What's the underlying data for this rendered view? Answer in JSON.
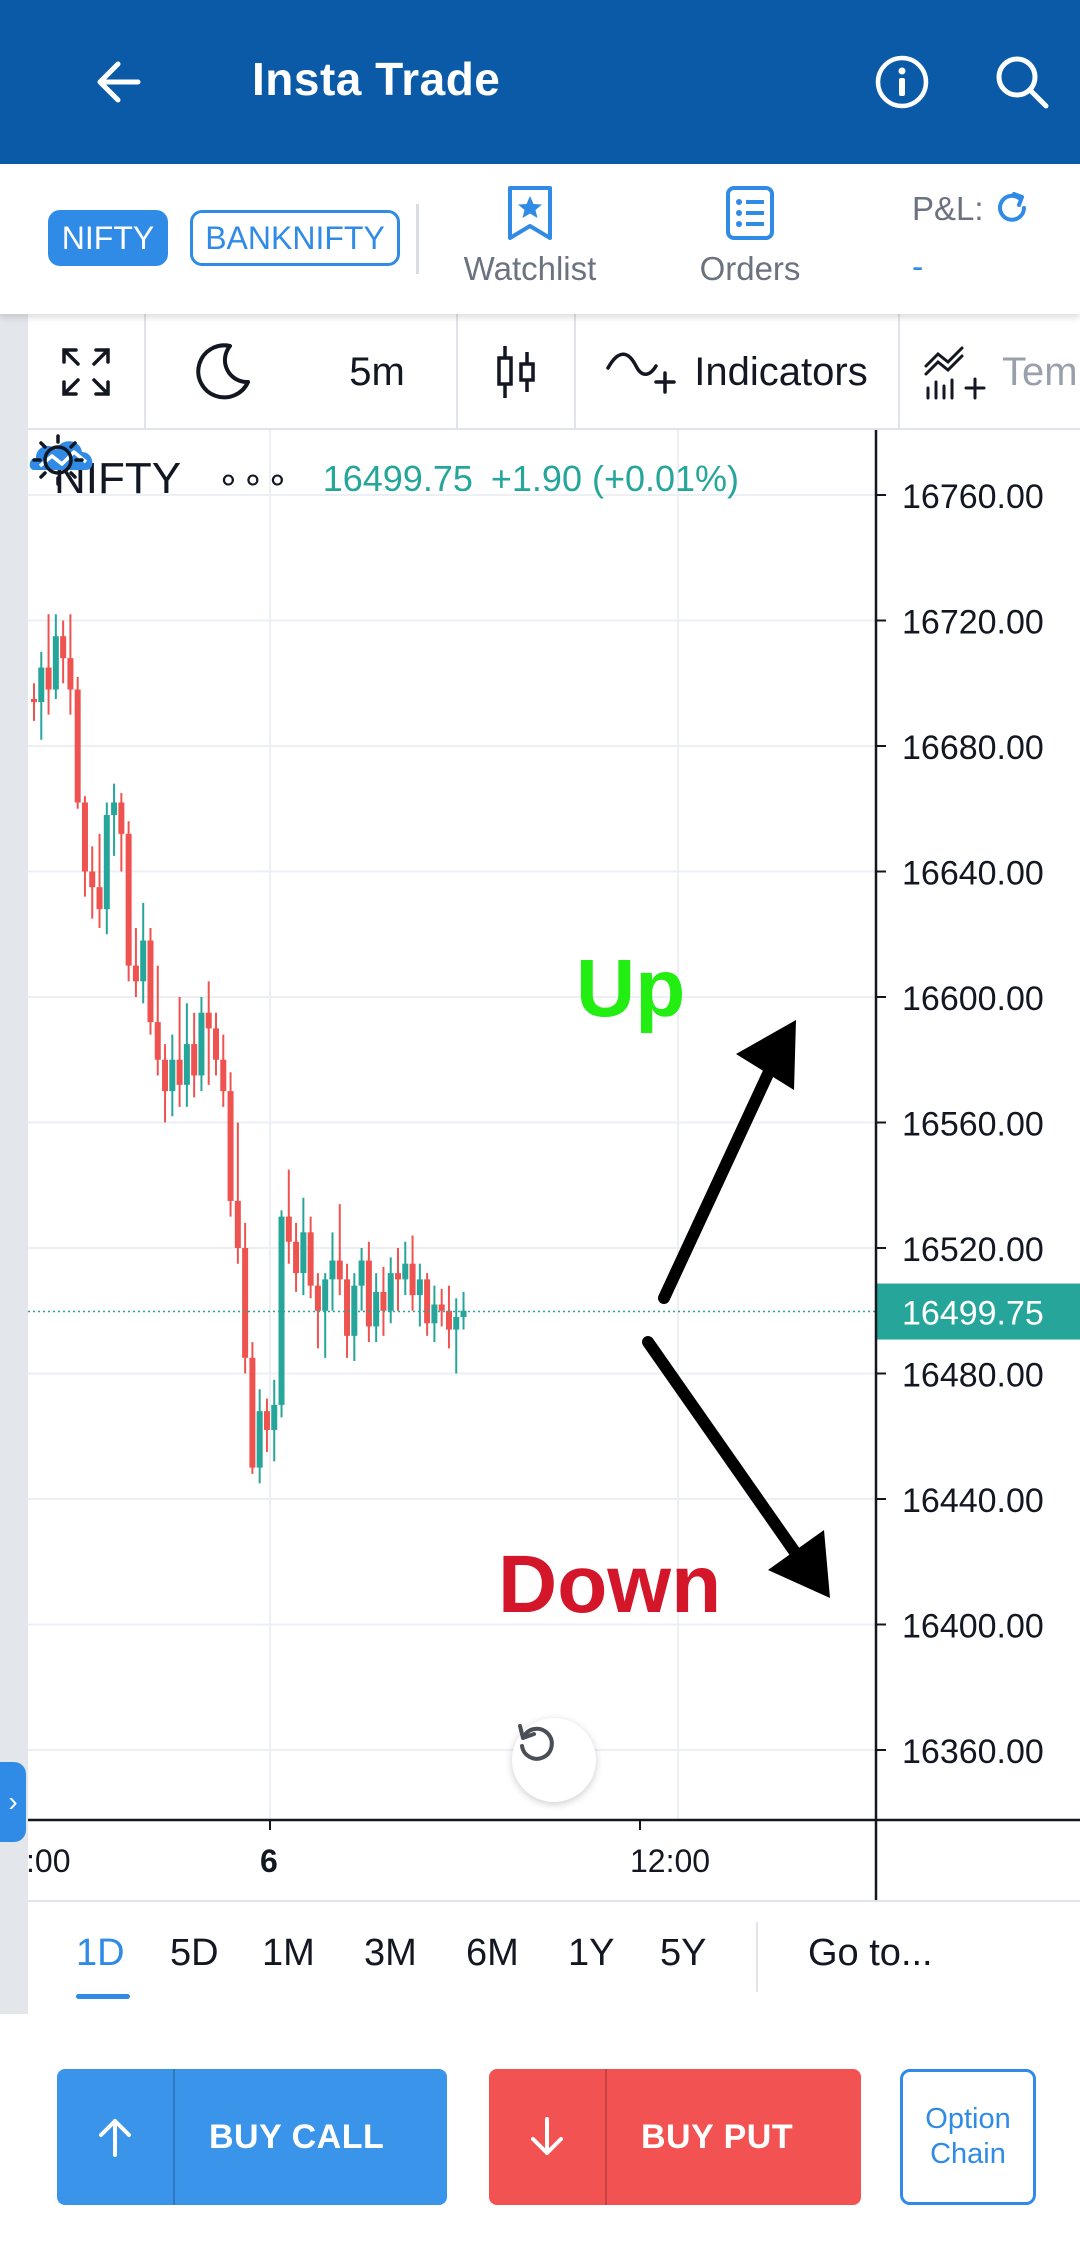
{
  "header": {
    "title": "Insta Trade"
  },
  "subbar": {
    "chips": [
      "NIFTY",
      "BANKNIFTY"
    ],
    "watchlist_label": "Watchlist",
    "orders_label": "Orders",
    "pnl_label": "P&L:",
    "pnl_value": "-"
  },
  "toolbar": {
    "interval": "5m",
    "indicators_label": "Indicators",
    "templates_label": "Temp"
  },
  "legend": {
    "symbol": "NIFTY",
    "dots": "∘∘∘",
    "price": "16499.75",
    "change": "+1.90 (+0.01%)"
  },
  "annotations": {
    "up": "Up",
    "down": "Down"
  },
  "chart_data": {
    "type": "candlestick",
    "y_ticks": [
      "16760.00",
      "16720.00",
      "16680.00",
      "16640.00",
      "16600.00",
      "16560.00",
      "16520.00",
      "16480.00",
      "16440.00",
      "16400.00",
      "16360.00"
    ],
    "y_range": [
      16340,
      16770
    ],
    "x_ticks": [
      ":00",
      "6",
      "12:00"
    ],
    "last_price": "16499.75",
    "colors": {
      "up": "#26a69a",
      "down": "#ef5350",
      "last_price_tag": "#26a69a"
    },
    "candles": [
      [
        16695,
        16700,
        16688,
        16694
      ],
      [
        16694,
        16710,
        16682,
        16705
      ],
      [
        16705,
        16722,
        16690,
        16698
      ],
      [
        16698,
        16722,
        16695,
        16715
      ],
      [
        16715,
        16720,
        16700,
        16708
      ],
      [
        16708,
        16722,
        16690,
        16698
      ],
      [
        16698,
        16702,
        16660,
        16662
      ],
      [
        16662,
        16664,
        16632,
        16640
      ],
      [
        16640,
        16648,
        16625,
        16635
      ],
      [
        16635,
        16652,
        16622,
        16628
      ],
      [
        16628,
        16662,
        16620,
        16658
      ],
      [
        16658,
        16668,
        16645,
        16662
      ],
      [
        16662,
        16665,
        16640,
        16652
      ],
      [
        16652,
        16656,
        16605,
        16610
      ],
      [
        16610,
        16622,
        16600,
        16605
      ],
      [
        16605,
        16630,
        16598,
        16618
      ],
      [
        16618,
        16622,
        16588,
        16592
      ],
      [
        16592,
        16610,
        16575,
        16580
      ],
      [
        16580,
        16585,
        16560,
        16570
      ],
      [
        16570,
        16588,
        16562,
        16580
      ],
      [
        16580,
        16600,
        16565,
        16572
      ],
      [
        16572,
        16598,
        16565,
        16585
      ],
      [
        16585,
        16595,
        16568,
        16575
      ],
      [
        16575,
        16600,
        16570,
        16595
      ],
      [
        16595,
        16605,
        16572,
        16590
      ],
      [
        16590,
        16595,
        16575,
        16580
      ],
      [
        16580,
        16588,
        16565,
        16570
      ],
      [
        16570,
        16576,
        16530,
        16535
      ],
      [
        16535,
        16560,
        16515,
        16520
      ],
      [
        16520,
        16528,
        16480,
        16485
      ],
      [
        16485,
        16490,
        16448,
        16450
      ],
      [
        16450,
        16475,
        16445,
        16468
      ],
      [
        16468,
        16472,
        16455,
        16462
      ],
      [
        16462,
        16478,
        16452,
        16470
      ],
      [
        16470,
        16532,
        16466,
        16530
      ],
      [
        16530,
        16545,
        16515,
        16522
      ],
      [
        16522,
        16528,
        16506,
        16512
      ],
      [
        16512,
        16536,
        16505,
        16525
      ],
      [
        16525,
        16530,
        16504,
        16508
      ],
      [
        16508,
        16512,
        16488,
        16500
      ],
      [
        16500,
        16512,
        16485,
        16510
      ],
      [
        16510,
        16525,
        16500,
        16516
      ],
      [
        16516,
        16534,
        16505,
        16510
      ],
      [
        16510,
        16515,
        16485,
        16492
      ],
      [
        16492,
        16512,
        16484,
        16508
      ],
      [
        16508,
        16520,
        16500,
        16516
      ],
      [
        16516,
        16522,
        16490,
        16495
      ],
      [
        16495,
        16512,
        16490,
        16506
      ],
      [
        16506,
        16514,
        16492,
        16500
      ],
      [
        16500,
        16517,
        16496,
        16512
      ],
      [
        16512,
        16520,
        16500,
        16510
      ],
      [
        16510,
        16522,
        16505,
        16515
      ],
      [
        16515,
        16524,
        16500,
        16505
      ],
      [
        16505,
        16515,
        16495,
        16510
      ],
      [
        16510,
        16512,
        16492,
        16496
      ],
      [
        16496,
        16508,
        16490,
        16502
      ],
      [
        16502,
        16507,
        16495,
        16500
      ],
      [
        16500,
        16508,
        16488,
        16494
      ],
      [
        16494,
        16504,
        16480,
        16498
      ],
      [
        16498,
        16506,
        16494,
        16500
      ]
    ]
  },
  "ranges": [
    "1D",
    "5D",
    "1M",
    "3M",
    "6M",
    "1Y",
    "5Y"
  ],
  "goto_label": "Go to...",
  "buttons": {
    "buy_call": "BUY CALL",
    "buy_put": "BUY PUT",
    "option_chain_1": "Option",
    "option_chain_2": "Chain"
  }
}
